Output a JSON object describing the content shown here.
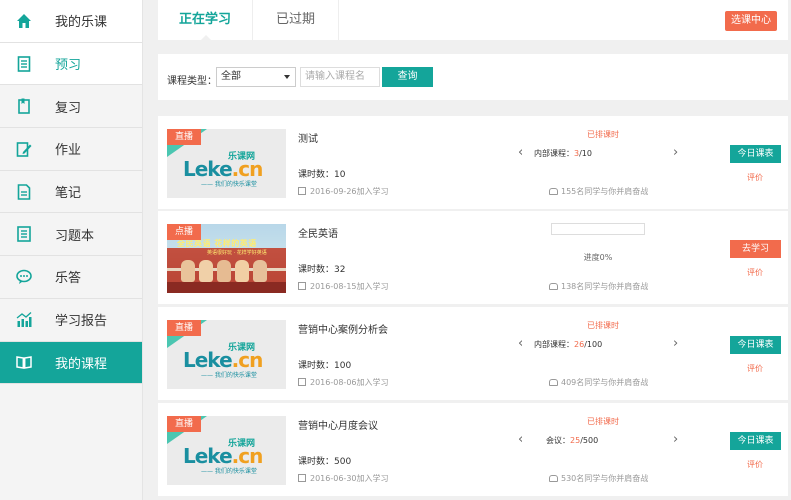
{
  "sidebar": {
    "items": [
      {
        "label": "我的乐课",
        "icon": "home-icon"
      },
      {
        "label": "预习",
        "icon": "document-icon"
      },
      {
        "label": "复习",
        "icon": "bookmark-icon"
      },
      {
        "label": "作业",
        "icon": "edit-icon"
      },
      {
        "label": "笔记",
        "icon": "note-icon"
      },
      {
        "label": "习题本",
        "icon": "list-icon"
      },
      {
        "label": "乐答",
        "icon": "chat-icon"
      },
      {
        "label": "学习报告",
        "icon": "chart-icon"
      },
      {
        "label": "我的课程",
        "icon": "book-icon"
      }
    ],
    "active_index": 8
  },
  "tabs": {
    "current": "正在学习",
    "expired": "已过期"
  },
  "select_center": "选课中心",
  "filter": {
    "label": "课程类型：",
    "selected": "全部",
    "search_placeholder": "请输入课程名",
    "search_button": "查询"
  },
  "logo": {
    "main": "Leke",
    "domain": ".cn",
    "cn": "乐课网",
    "slogan": "—— 我们的快乐课堂"
  },
  "poster": {
    "caption": "全民英语  花样的英语",
    "caption2": "英语很好玩 · 花样学好英语"
  },
  "courses": [
    {
      "badge": "直播",
      "title": "测试",
      "hours": "课时数：10",
      "date": "2016-09-26加入学习",
      "status": "已排课时",
      "pager_label": "内部课程：",
      "pager_done": "3",
      "pager_total": "/10",
      "peers": "155名同学与你并肩奋战",
      "action": "今日课表",
      "rate": "评价"
    },
    {
      "badge": "点播",
      "title": "全民英语",
      "hours": "课时数：32",
      "date": "2016-08-15加入学习",
      "progress_label": "进度0%",
      "progress": 0,
      "peers": "138名同学与你并肩奋战",
      "action": "去学习",
      "rate": "评价"
    },
    {
      "badge": "直播",
      "title": "营销中心案例分析会",
      "hours": "课时数：100",
      "date": "2016-08-06加入学习",
      "status": "已排课时",
      "pager_label": "内部课程：",
      "pager_done": "26",
      "pager_total": "/100",
      "peers": "409名同学与你并肩奋战",
      "action": "今日课表",
      "rate": "评价"
    },
    {
      "badge": "直播",
      "title": "营销中心月度会议",
      "hours": "课时数：500",
      "date": "2016-06-30加入学习",
      "status": "已排课时",
      "pager_label": "会议：",
      "pager_done": "25",
      "pager_total": "/500",
      "peers": "530名同学与你并肩奋战",
      "action": "今日课表",
      "rate": "评价"
    }
  ],
  "colors": {
    "accent": "#14a59a",
    "orange": "#f26b4c"
  }
}
